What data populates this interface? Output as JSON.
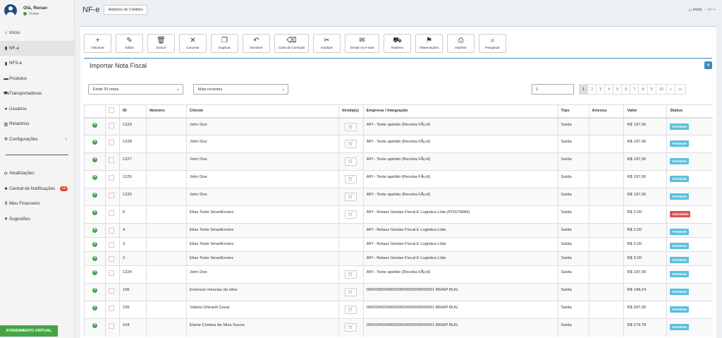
{
  "user": {
    "greeting": "Olá, Renan",
    "status": "Online"
  },
  "sidebar": {
    "items": [
      {
        "icon": "home-icon",
        "glyph": "⌂",
        "label": "Início"
      },
      {
        "icon": "file-icon",
        "glyph": "▮",
        "label": "NF-e",
        "active": true
      },
      {
        "icon": "file-icon",
        "glyph": "▮",
        "label": "NFS-e"
      },
      {
        "icon": "box-icon",
        "glyph": "▬",
        "label": "Produtos"
      },
      {
        "icon": "truck-icon",
        "glyph": "⛟",
        "label": "Transportadoras"
      },
      {
        "icon": "user-icon",
        "glyph": "●",
        "label": "Usuários"
      },
      {
        "icon": "bar-chart-icon",
        "glyph": "▥",
        "label": "Relatórios"
      },
      {
        "icon": "gear-icon",
        "glyph": "✲",
        "label": "Configurações"
      }
    ],
    "bottom_items": [
      {
        "icon": "refresh-icon",
        "glyph": "⟳",
        "label": "Atualizações"
      },
      {
        "icon": "bell-icon",
        "glyph": "♣",
        "label": "Central de Notificações",
        "badge": "15"
      },
      {
        "icon": "dollar-icon",
        "glyph": "$",
        "label": "Meu Financeiro"
      },
      {
        "icon": "heart-icon",
        "glyph": "♥",
        "label": "Sugestões"
      }
    ],
    "virtual_button": "ATENDIMENTO VIRTUAL"
  },
  "header": {
    "title": "NF-e",
    "credits_button": "Histórico de Créditos",
    "breadcrumb": [
      "Início",
      "NF-e"
    ]
  },
  "toolbar": [
    {
      "icon": "plus-icon",
      "glyph": "+",
      "label": "Adicionar"
    },
    {
      "icon": "edit-icon",
      "glyph": "✎",
      "label": "Editar"
    },
    {
      "icon": "trash-icon",
      "glyph": "🗑",
      "label": "Excluir"
    },
    {
      "icon": "close-icon",
      "glyph": "✕",
      "label": "Cancelar"
    },
    {
      "icon": "copy-icon",
      "glyph": "❐",
      "label": "Duplicar"
    },
    {
      "icon": "undo-icon",
      "glyph": "↶",
      "label": "Devolver"
    },
    {
      "icon": "eraser-icon",
      "glyph": "⌫",
      "label": "Carta de Correção",
      "wide": true
    },
    {
      "icon": "scissors-icon",
      "glyph": "✂",
      "label": "Inutilizar"
    },
    {
      "icon": "envelope-icon",
      "glyph": "✉",
      "label": "Enviar no e-mail",
      "wide": true
    },
    {
      "icon": "truck-icon",
      "glyph": "⛟",
      "label": "Rastreio"
    },
    {
      "icon": "flag-icon",
      "glyph": "⚑",
      "label": "Observações"
    },
    {
      "icon": "print-icon",
      "glyph": "⎙",
      "label": "Imprimir"
    },
    {
      "icon": "search-icon",
      "glyph": "⌕",
      "label": "Pesquisar"
    }
  ],
  "import_title": "Importar Nota Fiscal",
  "filters": {
    "per_page": "Exibir 25 notas",
    "order": "Mais recentes",
    "page_input": "1"
  },
  "pager": [
    "1",
    "2",
    "3",
    "4",
    "5",
    "6",
    "7",
    "8",
    "9",
    "10",
    "»",
    "»»"
  ],
  "columns": [
    "",
    "",
    "ID",
    "Número",
    "Cliente",
    "Venda(s)",
    "Empresa / Integração",
    "Tipo",
    "Anexos",
    "Valor",
    "Status"
  ],
  "rows": [
    {
      "id": "1229",
      "numero": "",
      "cliente": "John Doe",
      "cart": true,
      "empresa": "API - Teste apelido (Receba FÃ¡cil)",
      "tipo": "Saída",
      "valor": "R$ 197,90",
      "status": "Pendente"
    },
    {
      "id": "1228",
      "numero": "",
      "cliente": "John Doe",
      "cart": true,
      "empresa": "API - Teste apelido (Receba FÃ¡cil)",
      "tipo": "Saída",
      "valor": "R$ 197,90",
      "status": "Pendente"
    },
    {
      "id": "1227",
      "numero": "",
      "cliente": "John Doe",
      "cart": true,
      "empresa": "API - Teste apelido (Receba FÃ¡cil)",
      "tipo": "Saída",
      "valor": "R$ 197,90",
      "status": "Pendente"
    },
    {
      "id": "1226",
      "numero": "",
      "cliente": "John Doe",
      "cart": true,
      "empresa": "API - Teste apelido (Receba FÃ¡cil)",
      "tipo": "Saída",
      "valor": "R$ 197,90",
      "status": "Pendente"
    },
    {
      "id": "1225",
      "numero": "",
      "cliente": "John Doe",
      "cart": true,
      "empresa": "API - Teste apelido (Receba FÃ¡cil)",
      "tipo": "Saída",
      "valor": "R$ 197,90",
      "status": "Pendente"
    },
    {
      "id": "5",
      "numero": "",
      "cliente": "Elias Teste SmartEnvios",
      "cart": true,
      "empresa": "API - Notazz Gestao Fiscal E Logistica Ltda (POSTMAN)",
      "tipo": "Saída",
      "valor": "R$ 2,00",
      "status": "Cancelada"
    },
    {
      "id": "4",
      "numero": "",
      "cliente": "Elias Teste SmartEnvios",
      "cart": false,
      "empresa": "API - Notazz Gestao Fiscal E Logistica Ltda",
      "tipo": "Saída",
      "valor": "R$ 2,00",
      "status": "Pendente"
    },
    {
      "id": "3",
      "numero": "",
      "cliente": "Elias Teste SmartEnvios",
      "cart": false,
      "empresa": "API - Notazz Gestao Fiscal E Logistica Ltda",
      "tipo": "Saída",
      "valor": "R$ 2,00",
      "status": "Pendente"
    },
    {
      "id": "2",
      "numero": "",
      "cliente": "Elias Teste SmartEnvios",
      "cart": false,
      "empresa": "API - Notazz Gestao Fiscal E Logistica Ltda",
      "tipo": "Saída",
      "valor": "R$ 3,00",
      "status": "Pendente"
    },
    {
      "id": "1224",
      "numero": "",
      "cliente": "John Doe",
      "cart": true,
      "empresa": "API - Teste apelido (Receba FÃ¡cil)",
      "tipo": "Saída",
      "valor": "R$ 197,90",
      "status": "Pendente"
    },
    {
      "id": "106",
      "numero": "",
      "cliente": "Emerson messias da silva",
      "cart": true,
      "empresa": "000000000000000000000000000001 BRAIP BUG",
      "tipo": "Saída",
      "valor": "R$ 148,24",
      "status": "Pendente"
    },
    {
      "id": "105",
      "numero": "",
      "cliente": "Valeria Ghirardi Cezar",
      "cart": true,
      "empresa": "000000000000000000000000000001 BRAIP BUG",
      "tipo": "Saída",
      "valor": "R$ 397,00",
      "status": "Pendente"
    },
    {
      "id": "104",
      "numero": "",
      "cliente": "Elaine Cristina da Silva Souza",
      "cart": true,
      "empresa": "000000000000000000000000000001 BRAIP BUG",
      "tipo": "Saída",
      "valor": "R$ 279,78",
      "status": "Pendente"
    }
  ]
}
